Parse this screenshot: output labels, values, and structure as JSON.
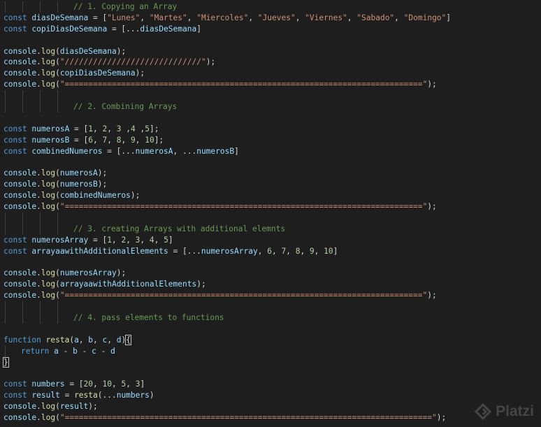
{
  "editor": {
    "lines": [
      {
        "indent": 4,
        "tokens": [
          [
            "cmt",
            "// 1. Copying an Array"
          ]
        ]
      },
      {
        "indent": 0,
        "tokens": [
          [
            "kw",
            "const "
          ],
          [
            "var",
            "diasDeSemana"
          ],
          [
            "pun",
            " = ["
          ],
          [
            "str",
            "\"Lunes\""
          ],
          [
            "pun",
            ", "
          ],
          [
            "str",
            "\"Martes\""
          ],
          [
            "pun",
            ", "
          ],
          [
            "str",
            "\"Miercoles\""
          ],
          [
            "pun",
            ", "
          ],
          [
            "str",
            "\"Jueves\""
          ],
          [
            "pun",
            ", "
          ],
          [
            "str",
            "\"Viernes\""
          ],
          [
            "pun",
            ", "
          ],
          [
            "str",
            "\"Sabado\""
          ],
          [
            "pun",
            ", "
          ],
          [
            "str",
            "\"Domingo\""
          ],
          [
            "pun",
            "]"
          ]
        ]
      },
      {
        "indent": 0,
        "tokens": [
          [
            "kw",
            "const "
          ],
          [
            "var",
            "copiDiasDeSemana"
          ],
          [
            "pun",
            " = [..."
          ],
          [
            "var",
            "diasDeSemana"
          ],
          [
            "pun",
            "]"
          ]
        ]
      },
      {
        "indent": 0,
        "tokens": []
      },
      {
        "indent": 0,
        "tokens": [
          [
            "var",
            "console"
          ],
          [
            "pun",
            "."
          ],
          [
            "fn",
            "log"
          ],
          [
            "pun",
            "("
          ],
          [
            "var",
            "diasDeSemana"
          ],
          [
            "pun",
            ");"
          ]
        ]
      },
      {
        "indent": 0,
        "tokens": [
          [
            "var",
            "console"
          ],
          [
            "pun",
            "."
          ],
          [
            "fn",
            "log"
          ],
          [
            "pun",
            "("
          ],
          [
            "str",
            "\"/////////////////////////////\""
          ],
          [
            "pun",
            ");"
          ]
        ]
      },
      {
        "indent": 0,
        "tokens": [
          [
            "var",
            "console"
          ],
          [
            "pun",
            "."
          ],
          [
            "fn",
            "log"
          ],
          [
            "pun",
            "("
          ],
          [
            "var",
            "copiDiasDeSemana"
          ],
          [
            "pun",
            ");"
          ]
        ]
      },
      {
        "indent": 0,
        "tokens": [
          [
            "var",
            "console"
          ],
          [
            "pun",
            "."
          ],
          [
            "fn",
            "log"
          ],
          [
            "pun",
            "("
          ],
          [
            "str",
            "\"============================================================================\""
          ],
          [
            "pun",
            ");"
          ]
        ]
      },
      {
        "indent": 4,
        "tokens": []
      },
      {
        "indent": 4,
        "tokens": [
          [
            "cmt",
            "// 2. Combining Arrays"
          ]
        ]
      },
      {
        "indent": 0,
        "tokens": []
      },
      {
        "indent": 0,
        "tokens": [
          [
            "kw",
            "const "
          ],
          [
            "var",
            "numerosA"
          ],
          [
            "pun",
            " = ["
          ],
          [
            "num",
            "1"
          ],
          [
            "pun",
            ", "
          ],
          [
            "num",
            "2"
          ],
          [
            "pun",
            ", "
          ],
          [
            "num",
            "3"
          ],
          [
            "pun",
            " ,"
          ],
          [
            "num",
            "4"
          ],
          [
            "pun",
            " ,"
          ],
          [
            "num",
            "5"
          ],
          [
            "pun",
            "];"
          ]
        ]
      },
      {
        "indent": 0,
        "tokens": [
          [
            "kw",
            "const "
          ],
          [
            "var",
            "numerosB"
          ],
          [
            "pun",
            " = ["
          ],
          [
            "num",
            "6"
          ],
          [
            "pun",
            ", "
          ],
          [
            "num",
            "7"
          ],
          [
            "pun",
            ", "
          ],
          [
            "num",
            "8"
          ],
          [
            "pun",
            ", "
          ],
          [
            "num",
            "9"
          ],
          [
            "pun",
            ", "
          ],
          [
            "num",
            "10"
          ],
          [
            "pun",
            "];"
          ]
        ]
      },
      {
        "indent": 0,
        "tokens": [
          [
            "kw",
            "const "
          ],
          [
            "var",
            "combinedNumeros"
          ],
          [
            "pun",
            " = [..."
          ],
          [
            "var",
            "numerosA"
          ],
          [
            "pun",
            ", ..."
          ],
          [
            "var",
            "numerosB"
          ],
          [
            "pun",
            "]"
          ]
        ]
      },
      {
        "indent": 0,
        "tokens": []
      },
      {
        "indent": 0,
        "tokens": [
          [
            "var",
            "console"
          ],
          [
            "pun",
            "."
          ],
          [
            "fn",
            "log"
          ],
          [
            "pun",
            "("
          ],
          [
            "var",
            "numerosA"
          ],
          [
            "pun",
            ");"
          ]
        ]
      },
      {
        "indent": 0,
        "tokens": [
          [
            "var",
            "console"
          ],
          [
            "pun",
            "."
          ],
          [
            "fn",
            "log"
          ],
          [
            "pun",
            "("
          ],
          [
            "var",
            "numerosB"
          ],
          [
            "pun",
            ");"
          ]
        ]
      },
      {
        "indent": 0,
        "tokens": [
          [
            "var",
            "console"
          ],
          [
            "pun",
            "."
          ],
          [
            "fn",
            "log"
          ],
          [
            "pun",
            "("
          ],
          [
            "var",
            "combinedNumeros"
          ],
          [
            "pun",
            ");"
          ]
        ]
      },
      {
        "indent": 0,
        "tokens": [
          [
            "var",
            "console"
          ],
          [
            "pun",
            "."
          ],
          [
            "fn",
            "log"
          ],
          [
            "pun",
            "("
          ],
          [
            "str",
            "\"============================================================================\""
          ],
          [
            "pun",
            ");"
          ]
        ]
      },
      {
        "indent": 4,
        "tokens": []
      },
      {
        "indent": 4,
        "tokens": [
          [
            "cmt",
            "// 3. creating Arrays with additional elemnts"
          ]
        ]
      },
      {
        "indent": 0,
        "tokens": [
          [
            "kw",
            "const "
          ],
          [
            "var",
            "numerosArray"
          ],
          [
            "pun",
            " = ["
          ],
          [
            "num",
            "1"
          ],
          [
            "pun",
            ", "
          ],
          [
            "num",
            "2"
          ],
          [
            "pun",
            ", "
          ],
          [
            "num",
            "3"
          ],
          [
            "pun",
            ", "
          ],
          [
            "num",
            "4"
          ],
          [
            "pun",
            ", "
          ],
          [
            "num",
            "5"
          ],
          [
            "pun",
            "]"
          ]
        ]
      },
      {
        "indent": 0,
        "tokens": [
          [
            "kw",
            "const "
          ],
          [
            "var",
            "arrayaawithAdditionalElements"
          ],
          [
            "pun",
            " = [..."
          ],
          [
            "var",
            "numerosArray"
          ],
          [
            "pun",
            ", "
          ],
          [
            "num",
            "6"
          ],
          [
            "pun",
            ", "
          ],
          [
            "num",
            "7"
          ],
          [
            "pun",
            ", "
          ],
          [
            "num",
            "8"
          ],
          [
            "pun",
            ", "
          ],
          [
            "num",
            "9"
          ],
          [
            "pun",
            ", "
          ],
          [
            "num",
            "10"
          ],
          [
            "pun",
            "]"
          ]
        ]
      },
      {
        "indent": 0,
        "tokens": []
      },
      {
        "indent": 0,
        "tokens": [
          [
            "var",
            "console"
          ],
          [
            "pun",
            "."
          ],
          [
            "fn",
            "log"
          ],
          [
            "pun",
            "("
          ],
          [
            "var",
            "numerosArray"
          ],
          [
            "pun",
            ");"
          ]
        ]
      },
      {
        "indent": 0,
        "tokens": [
          [
            "var",
            "console"
          ],
          [
            "pun",
            "."
          ],
          [
            "fn",
            "log"
          ],
          [
            "pun",
            "("
          ],
          [
            "var",
            "arrayaawithAdditionalElements"
          ],
          [
            "pun",
            ");"
          ]
        ]
      },
      {
        "indent": 0,
        "tokens": [
          [
            "var",
            "console"
          ],
          [
            "pun",
            "."
          ],
          [
            "fn",
            "log"
          ],
          [
            "pun",
            "("
          ],
          [
            "str",
            "\"============================================================================\""
          ],
          [
            "pun",
            ");"
          ]
        ]
      },
      {
        "indent": 4,
        "tokens": []
      },
      {
        "indent": 4,
        "tokens": [
          [
            "cmt",
            "// 4. pass elements to functions"
          ]
        ]
      },
      {
        "indent": 0,
        "tokens": []
      },
      {
        "indent": 0,
        "tokens": [
          [
            "kw",
            "function "
          ],
          [
            "fn",
            "resta"
          ],
          [
            "pun",
            "("
          ],
          [
            "var",
            "a"
          ],
          [
            "pun",
            ", "
          ],
          [
            "var",
            "b"
          ],
          [
            "pun",
            ", "
          ],
          [
            "var",
            "c"
          ],
          [
            "pun",
            ", "
          ],
          [
            "var",
            "d"
          ],
          [
            "pun",
            ")"
          ],
          [
            "pun",
            "{"
          ]
        ]
      },
      {
        "indent": 1,
        "tokens": [
          [
            "kw",
            "return "
          ],
          [
            "var",
            "a"
          ],
          [
            "pun",
            " - "
          ],
          [
            "var",
            "b"
          ],
          [
            "pun",
            " - "
          ],
          [
            "var",
            "c"
          ],
          [
            "pun",
            " - "
          ],
          [
            "var",
            "d"
          ]
        ]
      },
      {
        "indent": 0,
        "tokens": [
          [
            "pun",
            "}"
          ]
        ]
      },
      {
        "indent": 0,
        "tokens": []
      },
      {
        "indent": 0,
        "tokens": [
          [
            "kw",
            "const "
          ],
          [
            "var",
            "numbers"
          ],
          [
            "pun",
            " = ["
          ],
          [
            "num",
            "20"
          ],
          [
            "pun",
            ", "
          ],
          [
            "num",
            "10"
          ],
          [
            "pun",
            ", "
          ],
          [
            "num",
            "5"
          ],
          [
            "pun",
            ", "
          ],
          [
            "num",
            "3"
          ],
          [
            "pun",
            "]"
          ]
        ]
      },
      {
        "indent": 0,
        "tokens": [
          [
            "kw",
            "const "
          ],
          [
            "var",
            "result"
          ],
          [
            "pun",
            " = "
          ],
          [
            "fn",
            "resta"
          ],
          [
            "pun",
            "(..."
          ],
          [
            "var",
            "numbers"
          ],
          [
            "pun",
            ")"
          ]
        ]
      },
      {
        "indent": 0,
        "tokens": [
          [
            "var",
            "console"
          ],
          [
            "pun",
            "."
          ],
          [
            "fn",
            "log"
          ],
          [
            "pun",
            "("
          ],
          [
            "var",
            "result"
          ],
          [
            "pun",
            ");"
          ]
        ]
      },
      {
        "indent": 0,
        "tokens": [
          [
            "var",
            "console"
          ],
          [
            "pun",
            "."
          ],
          [
            "fn",
            "log"
          ],
          [
            "pun",
            "("
          ],
          [
            "str",
            "\"==============================================================================\""
          ],
          [
            "pun",
            ");"
          ]
        ]
      }
    ]
  },
  "watermark": {
    "text": "Platzi",
    "icon": "platzi-logo-icon"
  },
  "colors": {
    "background": "#1e1e1e",
    "keyword": "#569cd6",
    "variable": "#9cdcfe",
    "function": "#dcdcaa",
    "string": "#ce9178",
    "number": "#b5cea8",
    "comment": "#6a9955"
  }
}
